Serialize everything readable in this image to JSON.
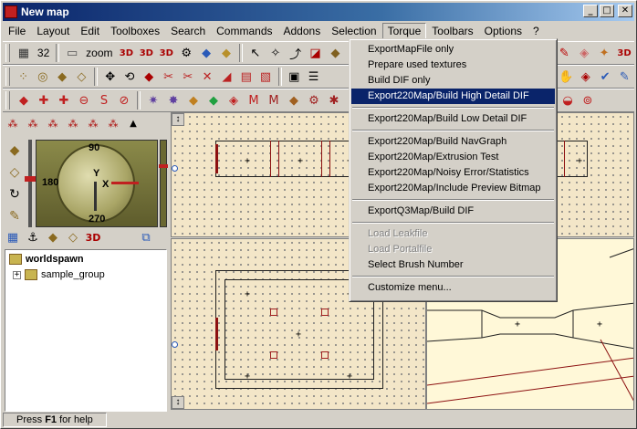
{
  "window": {
    "title": "New map"
  },
  "menubar": [
    "File",
    "Layout",
    "Edit",
    "Toolboxes",
    "Search",
    "Commands",
    "Addons",
    "Selection",
    "Torque",
    "Toolbars",
    "Options",
    "?"
  ],
  "toolbar1": {
    "grid_value": "32",
    "zoom_label": "zoom"
  },
  "compass": {
    "north": "90",
    "south": "270",
    "west": "180",
    "axis_x": "X",
    "axis_y": "Y"
  },
  "tree": {
    "root": "worldspawn",
    "child": "sample_group"
  },
  "viewtabs": {
    "label_3d": "3D"
  },
  "status": {
    "prefix": "Press",
    "key": "F1",
    "suffix": "for help"
  },
  "torque_menu": {
    "groups": [
      [
        {
          "label": "ExportMapFile only"
        },
        {
          "label": "Prepare used textures"
        },
        {
          "label": "Build DIF only"
        },
        {
          "label": "Export220Map/Build High Detail DIF",
          "highlighted": true
        }
      ],
      [
        {
          "label": "Export220Map/Build Low Detail DIF"
        }
      ],
      [
        {
          "label": "Export220Map/Build NavGraph"
        },
        {
          "label": "Export220Map/Extrusion Test"
        },
        {
          "label": "Export220Map/Noisy Error/Statistics"
        },
        {
          "label": "Export220Map/Include Preview Bitmap"
        }
      ],
      [
        {
          "label": "ExportQ3Map/Build DIF"
        }
      ],
      [
        {
          "label": "Load Leakfile",
          "disabled": true
        },
        {
          "label": "Load Portalfile",
          "disabled": true
        },
        {
          "label": "Select Brush Number"
        }
      ],
      [
        {
          "label": "Customize menu..."
        }
      ]
    ]
  },
  "colors": {
    "titlebar": "#0a246a",
    "viewport_bg": "#f3e6c8",
    "highlight": "#0a246a",
    "brush_red": "#8c1010"
  }
}
